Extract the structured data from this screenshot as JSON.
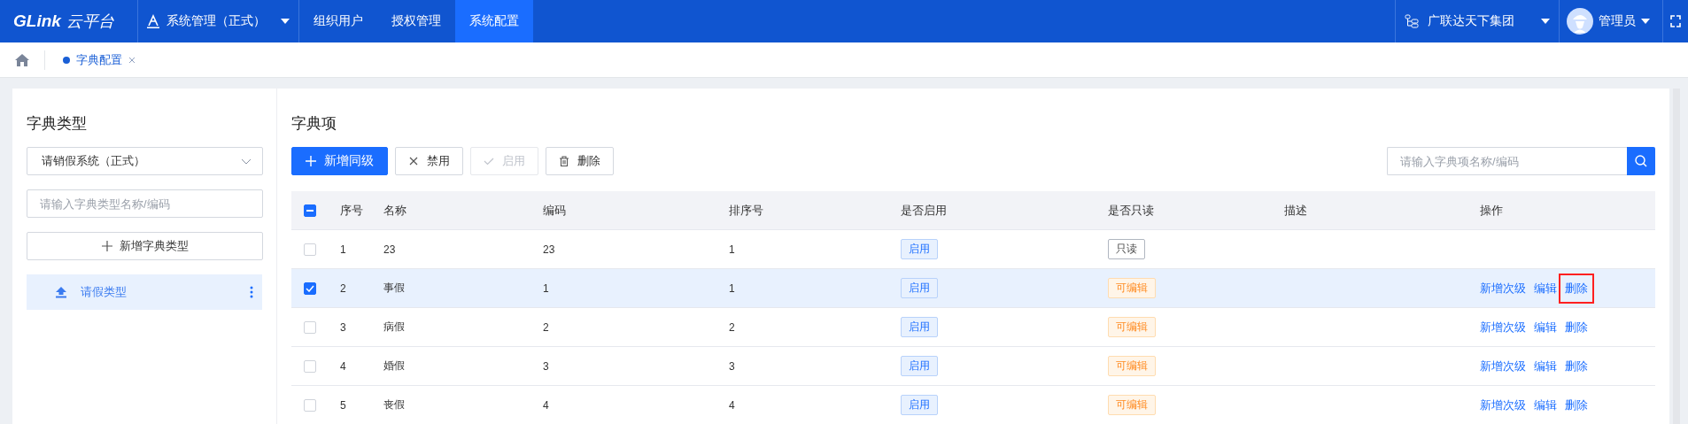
{
  "header": {
    "logo": {
      "brand": "GLink",
      "suffix": "云平台"
    },
    "system_selector": {
      "label": "系统管理（正式）"
    },
    "nav": [
      {
        "label": "组织用户",
        "selected": false
      },
      {
        "label": "授权管理",
        "selected": false
      },
      {
        "label": "系统配置",
        "selected": true
      }
    ],
    "org_selector": {
      "label": "广联达天下集团"
    },
    "user": {
      "name": "管理员"
    }
  },
  "tabs": [
    {
      "label": "字典配置",
      "selected": true
    }
  ],
  "type_panel": {
    "title": "字典类型",
    "system_select": {
      "value": "请销假系统（正式）"
    },
    "search": {
      "placeholder": "请输入字典类型名称/编码"
    },
    "add_button": "新增字典类型",
    "types": [
      {
        "label": "请假类型",
        "selected": true
      }
    ]
  },
  "items_panel": {
    "title": "字典项",
    "toolbar": [
      {
        "label": "新增同级",
        "kind": "add",
        "disabled": false
      },
      {
        "label": "禁用",
        "kind": "disable",
        "disabled": false
      },
      {
        "label": "启用",
        "kind": "enable",
        "disabled": true
      },
      {
        "label": "删除",
        "kind": "delete",
        "disabled": false
      }
    ],
    "search": {
      "placeholder": "请输入字典项名称/编码"
    },
    "table": {
      "select_all": {
        "indeterminate": true
      },
      "columns": [
        "序号",
        "名称",
        "编码",
        "排序号",
        "是否启用",
        "是否只读",
        "描述",
        "操作"
      ],
      "rows": [
        {
          "selected": false,
          "index": "1",
          "name": "23",
          "code": "23",
          "order": "1",
          "enabled": "启用",
          "access": {
            "label": "只读",
            "readonly": true
          },
          "actions": []
        },
        {
          "selected": true,
          "index": "2",
          "name": "事假",
          "code": "1",
          "order": "1",
          "enabled": "启用",
          "access": {
            "label": "可编辑",
            "readonly": false
          },
          "actions": [
            {
              "label": "新增次级",
              "outlined": false
            },
            {
              "label": "编辑",
              "outlined": false
            },
            {
              "label": "删除",
              "outlined": true
            }
          ]
        },
        {
          "selected": false,
          "index": "3",
          "name": "病假",
          "code": "2",
          "order": "2",
          "enabled": "启用",
          "access": {
            "label": "可编辑",
            "readonly": false
          },
          "actions": [
            {
              "label": "新增次级",
              "outlined": false
            },
            {
              "label": "编辑",
              "outlined": false
            },
            {
              "label": "删除",
              "outlined": false
            }
          ]
        },
        {
          "selected": false,
          "index": "4",
          "name": "婚假",
          "code": "3",
          "order": "3",
          "enabled": "启用",
          "access": {
            "label": "可编辑",
            "readonly": false
          },
          "actions": [
            {
              "label": "新增次级",
              "outlined": false
            },
            {
              "label": "编辑",
              "outlined": false
            },
            {
              "label": "删除",
              "outlined": false
            }
          ]
        },
        {
          "selected": false,
          "index": "5",
          "name": "丧假",
          "code": "4",
          "order": "4",
          "enabled": "启用",
          "access": {
            "label": "可编辑",
            "readonly": false
          },
          "actions": [
            {
              "label": "新增次级",
              "outlined": false
            },
            {
              "label": "编辑",
              "outlined": false
            },
            {
              "label": "删除",
              "outlined": false
            }
          ]
        }
      ]
    }
  }
}
